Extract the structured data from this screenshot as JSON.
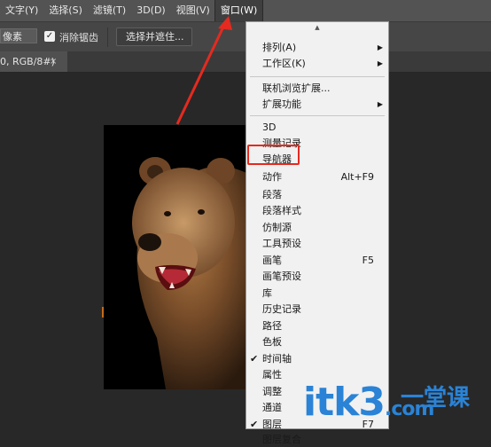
{
  "menubar": {
    "items": [
      "文字(Y)",
      "选择(S)",
      "滤镜(T)",
      "3D(D)",
      "视图(V)",
      "窗口(W)"
    ]
  },
  "options": {
    "field_value": "像素",
    "checkbox_label": "消除锯齿",
    "checkbox_checked": true,
    "select_mask_button": "选择并遮住..."
  },
  "document_tab": {
    "title": "0, RGB/8#)",
    "close": "×"
  },
  "window_menu": {
    "groups": [
      [
        {
          "label": "排列(A)",
          "submenu": true
        },
        {
          "label": "工作区(K)",
          "submenu": true
        }
      ],
      [
        {
          "label": "联机浏览扩展..."
        },
        {
          "label": "扩展功能",
          "submenu": true
        }
      ],
      [
        {
          "label": "3D"
        },
        {
          "label": "测量记录"
        },
        {
          "label": "导航器"
        },
        {
          "label": "动作",
          "shortcut": "Alt+F9"
        },
        {
          "label": "段落"
        },
        {
          "label": "段落样式"
        },
        {
          "label": "仿制源"
        },
        {
          "label": "工具预设"
        },
        {
          "label": "画笔",
          "shortcut": "F5"
        },
        {
          "label": "画笔预设"
        },
        {
          "label": "库"
        },
        {
          "label": "历史记录"
        },
        {
          "label": "路径"
        },
        {
          "label": "色板"
        },
        {
          "label": "时间轴",
          "checked": true
        },
        {
          "label": "属性"
        },
        {
          "label": "调整"
        },
        {
          "label": "通道"
        },
        {
          "label": "图层",
          "shortcut": "F7",
          "checked": true
        },
        {
          "label": "图层复合"
        }
      ]
    ]
  },
  "watermark": {
    "brand": "itk3",
    "suffix": ".com",
    "cn": "一堂课"
  },
  "colors": {
    "highlight": "#e52a1f",
    "watermark": "#2a83d6"
  }
}
